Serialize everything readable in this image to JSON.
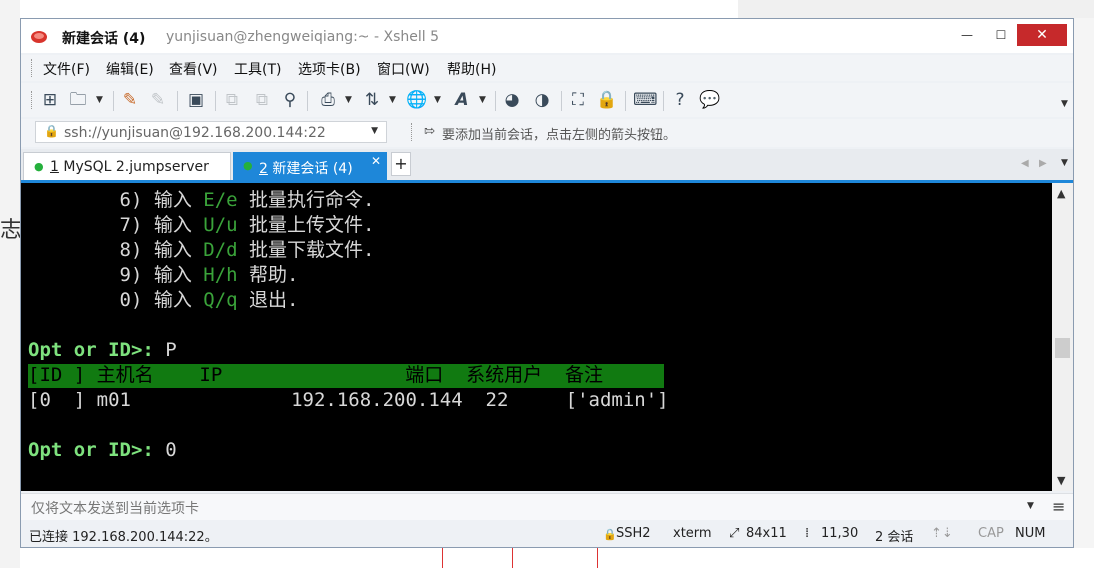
{
  "window": {
    "title_main": "新建会话 (4)",
    "title_sub": "yunjisuan@zhengweiqiang:~ - Xshell 5",
    "controls": {
      "minimize": "—",
      "maximize": "☐",
      "close": "✕"
    }
  },
  "menu": [
    "文件(F)",
    "编辑(E)",
    "查看(V)",
    "工具(T)",
    "选项卡(B)",
    "窗口(W)",
    "帮助(H)"
  ],
  "address": {
    "value": "ssh://yunjisuan@192.168.200.144:22",
    "hint": "要添加当前会话，点击左侧的箭头按钮。"
  },
  "tabs": [
    {
      "number": "1",
      "label": "MySQL 2.jumpserver",
      "active": false
    },
    {
      "number": "2",
      "label": "新建会话 (4)",
      "active": true
    }
  ],
  "terminal": {
    "menu_lines": [
      {
        "num": "6) 输入 ",
        "key": "E/e",
        "desc": " 批量执行命令."
      },
      {
        "num": "7) 输入 ",
        "key": "U/u",
        "desc": " 批量上传文件."
      },
      {
        "num": "8) 输入 ",
        "key": "D/d",
        "desc": " 批量下载文件."
      },
      {
        "num": "9) 输入 ",
        "key": "H/h",
        "desc": " 帮助."
      },
      {
        "num": "0) 输入 ",
        "key": "Q/q",
        "desc": " 退出."
      }
    ],
    "prompt1": "Opt or ID>:",
    "input1": " P",
    "table_header": "[ID ] 主机名    IP                端口  系统用户  备注",
    "table_row": "[0  ] m01              192.168.200.144  22     ['admin']",
    "prompt2": "Opt or ID>:",
    "input2": " 0"
  },
  "sendbar": {
    "placeholder": "仅将文本发送到当前选项卡"
  },
  "status": {
    "connection": "已连接 192.168.200.144:22。",
    "protocol": "SSH2",
    "term": "xterm",
    "size": "84x11",
    "cursor": "11,30",
    "sessions": "2 会话",
    "caps": "CAP",
    "num": "NUM"
  },
  "colors": {
    "accent": "#1e87d9",
    "terminal_bg": "#000000",
    "prompt_green": "#7ee27e",
    "key_green": "#3aa33a",
    "header_green": "#117a11",
    "close_red": "#c6292b"
  }
}
